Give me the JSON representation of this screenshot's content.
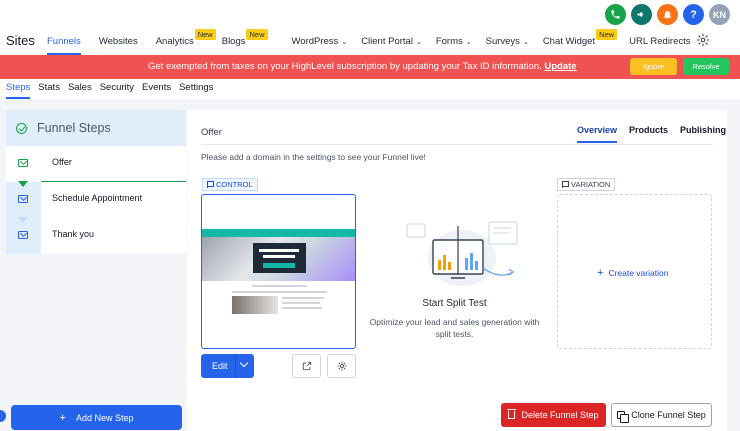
{
  "header": {
    "icons": [
      "phone-icon",
      "megaphone-icon",
      "bell-icon",
      "help-icon"
    ],
    "help_label": "?",
    "avatar": "KN"
  },
  "nav": {
    "section": "Sites",
    "items": [
      {
        "label": "Funnels",
        "active": true
      },
      {
        "label": "Websites"
      },
      {
        "label": "Analytics",
        "badge": "New"
      },
      {
        "label": "Blogs",
        "badge": "New"
      },
      {
        "label": "WordPress",
        "dropdown": true
      },
      {
        "label": "Client Portal",
        "dropdown": true
      },
      {
        "label": "Forms",
        "dropdown": true
      },
      {
        "label": "Surveys",
        "dropdown": true
      },
      {
        "label": "Chat Widget",
        "badge": "New"
      },
      {
        "label": "URL Redirects"
      }
    ]
  },
  "banner": {
    "text": "Get exempted from taxes on your HighLevel subscription by updating your Tax ID information.",
    "link": "Update",
    "ignore": "Ignore",
    "resolve": "Resolve",
    "color": "#f05252"
  },
  "subtabs": [
    "Steps",
    "Stats",
    "Sales",
    "Security",
    "Events",
    "Settings"
  ],
  "steps_panel": {
    "title": "Funnel Steps",
    "steps": [
      "Offer",
      "Schedule Appointment",
      "Thank you"
    ],
    "add_button": "Add New Step"
  },
  "main": {
    "title": "Offer",
    "tabs": [
      "Overview",
      "Products",
      "Publishing"
    ],
    "note": "Please add a domain in the settings to see your Funnel live!",
    "control_label": "CONTROL",
    "variation_label": "VARIATION",
    "preview_headline": "CLAIM YOUR FREE TUTORIAL",
    "edit_label": "Edit",
    "split_title": "Start Split Test",
    "split_desc": "Optimize your lead and sales generation with split tests.",
    "create_variation": "Create variation",
    "delete_label": "Delete Funnel Step",
    "clone_label": "Clone Funnel Step"
  },
  "colors": {
    "accent": "#2563eb",
    "danger": "#dc2626",
    "success": "#16a34a"
  }
}
